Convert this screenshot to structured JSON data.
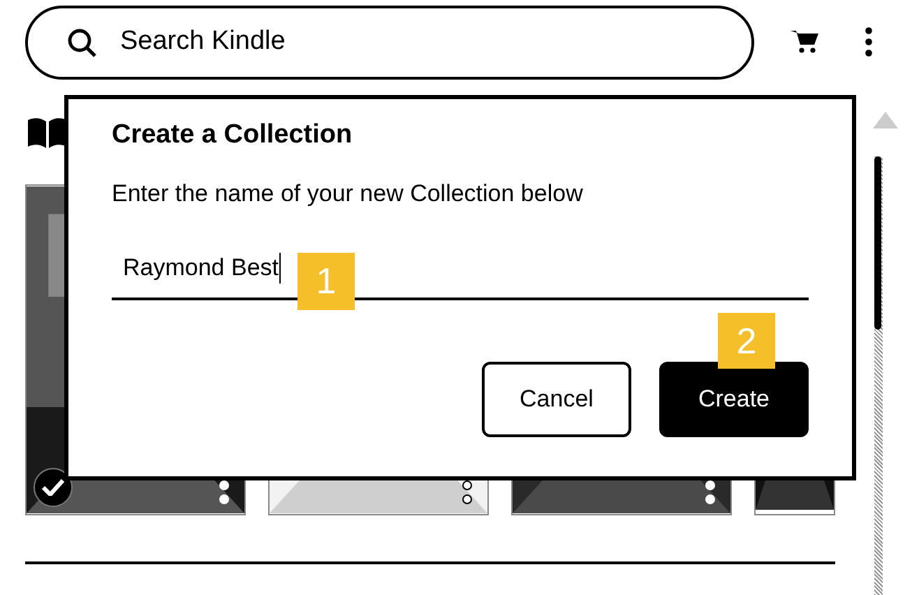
{
  "search": {
    "placeholder": "Search Kindle"
  },
  "books": [
    {
      "kind": "picture",
      "checked": true
    },
    {
      "kind": "picture",
      "checked": false
    },
    {
      "kind": "picture",
      "checked": false
    },
    {
      "kind": "picture",
      "checked": false
    }
  ],
  "dialog": {
    "title": "Create a Collection",
    "message": "Enter the name of your new Collection below",
    "input_value": "Raymond Best",
    "buttons": [
      {
        "label": "Cancel",
        "kind": "secondary"
      },
      {
        "label": "Create",
        "kind": "primary"
      }
    ]
  },
  "callouts": [
    "1",
    "2"
  ]
}
